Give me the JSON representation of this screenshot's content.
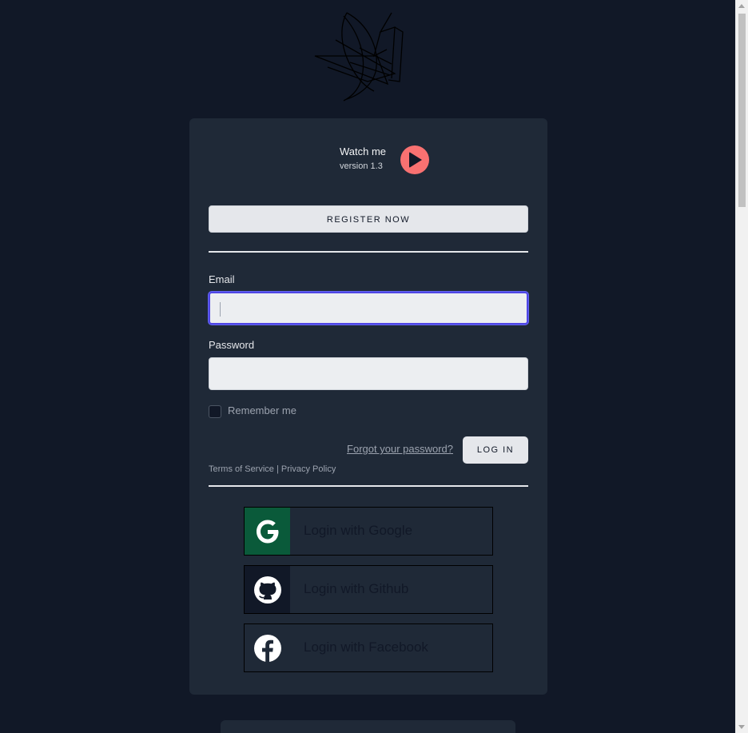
{
  "brand": {
    "title": "Watch me",
    "version": "version 1.3"
  },
  "register": {
    "label": "REGISTER NOW"
  },
  "form": {
    "email_label": "Email",
    "email_value": "",
    "password_label": "Password",
    "password_value": "",
    "remember_label": "Remember me",
    "remember_checked": false,
    "forgot_label": "Forgot your password?",
    "login_label": "LOG IN",
    "legal": "Terms of Service | Privacy Policy"
  },
  "social": {
    "google_label": "Login with Google",
    "github_label": "Login with Github",
    "facebook_label": "Login with Facebook"
  },
  "icons": {
    "logo": "sailboat-sketch-logo",
    "play": "play-icon",
    "google": "google-icon",
    "github": "github-icon",
    "facebook": "facebook-icon"
  },
  "colors": {
    "background": "#111827",
    "card": "#1f2937",
    "accent_play": "#f87171",
    "focus_ring": "#4f46e5",
    "google_bg": "#0a5a3a"
  }
}
